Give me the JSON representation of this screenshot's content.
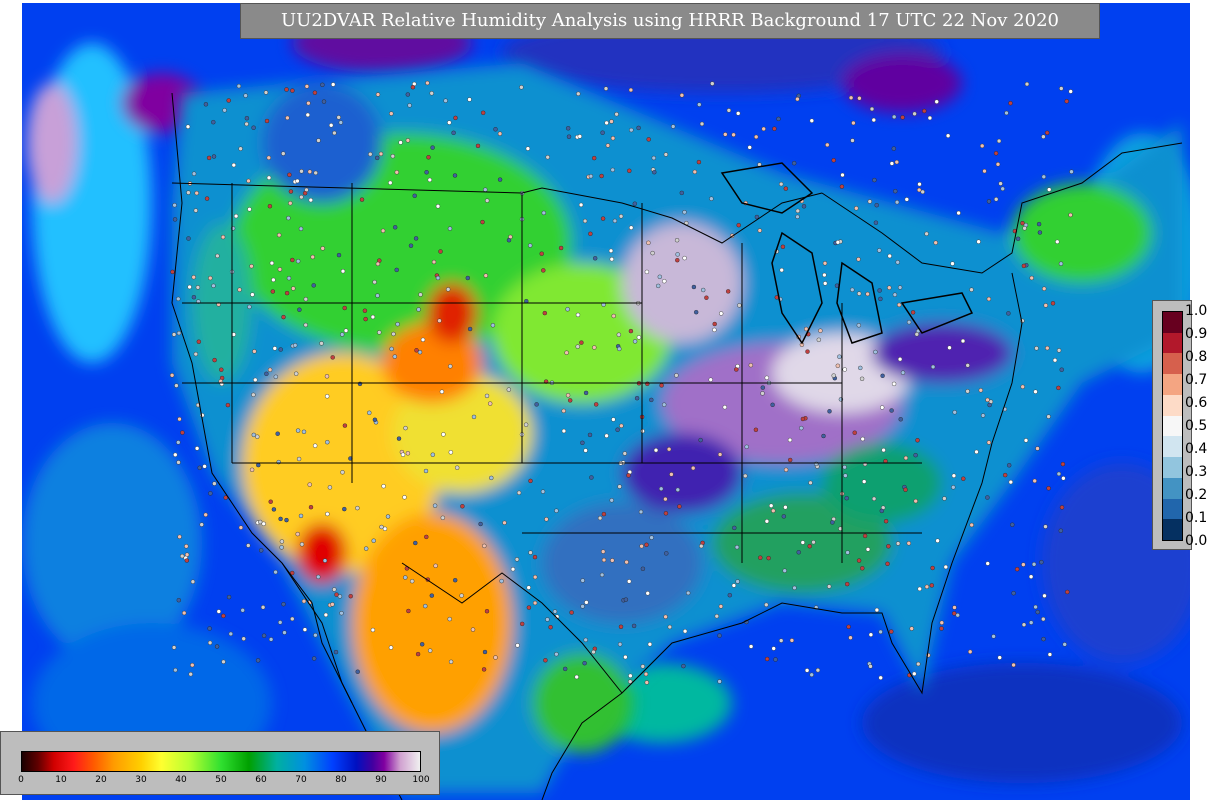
{
  "title": "UU2DVAR Relative Humidity Analysis using HRRR Background 17 UTC 22 Nov 2020",
  "ob_colorbar": {
    "ticks": [
      "1.0",
      "0.9",
      "0.8",
      "0.7",
      "0.6",
      "0.5",
      "0.4",
      "0.3",
      "0.2",
      "0.1",
      "0.0"
    ],
    "colors": [
      "#67001f",
      "#b2182b",
      "#d6604d",
      "#f4a582",
      "#fddbc7",
      "#f7f7f7",
      "#d1e5f0",
      "#92c5de",
      "#4393c3",
      "#2166ac",
      "#053061"
    ]
  },
  "rh_colorbar": {
    "ticks": [
      "0",
      "10",
      "20",
      "30",
      "40",
      "50",
      "60",
      "70",
      "80",
      "90",
      "100"
    ]
  },
  "palette": {
    "ocean_blue": "#0050ff",
    "ocean_deep": "#1a30c0",
    "dry_red": "#e00000",
    "dry_orange": "#ff9a00",
    "dry_yellow": "#ffe020",
    "mid_green": "#30d030",
    "moist_teal": "#10a0a0",
    "saturated_purple": "#7000a0",
    "saturated_white": "#e8e0ee"
  }
}
